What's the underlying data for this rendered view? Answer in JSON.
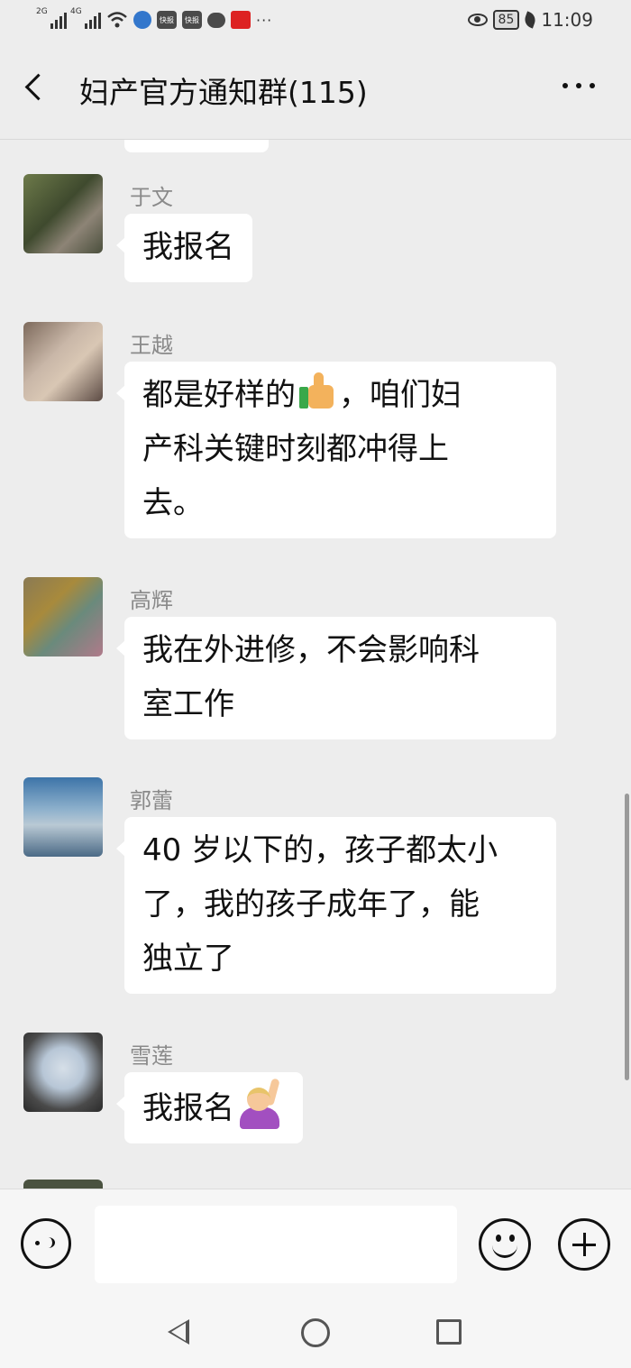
{
  "status_bar": {
    "signal_1": "2G",
    "signal_2": "4G",
    "app_1": "快报",
    "app_2": "快报",
    "more": "···",
    "battery": "85",
    "time": "11:09"
  },
  "header": {
    "title": "妇产官方通知群(115)"
  },
  "messages": [
    {
      "sender": "于文",
      "lines": [
        "我报名"
      ]
    },
    {
      "sender": "王越",
      "lines": [
        "都是好样的",
        "，咱们妇",
        "产科关键时刻都冲得上",
        "去。"
      ]
    },
    {
      "sender": "高辉",
      "lines": [
        "我在外进修，不会影响科",
        "室工作"
      ]
    },
    {
      "sender": "郭蕾",
      "lines": [
        "40 岁以下的，孩子都太小",
        "了，我的孩子成年了，能",
        "独立了"
      ]
    },
    {
      "sender": "雪莲",
      "lines": [
        "我报名"
      ]
    }
  ],
  "input": {
    "value": ""
  }
}
